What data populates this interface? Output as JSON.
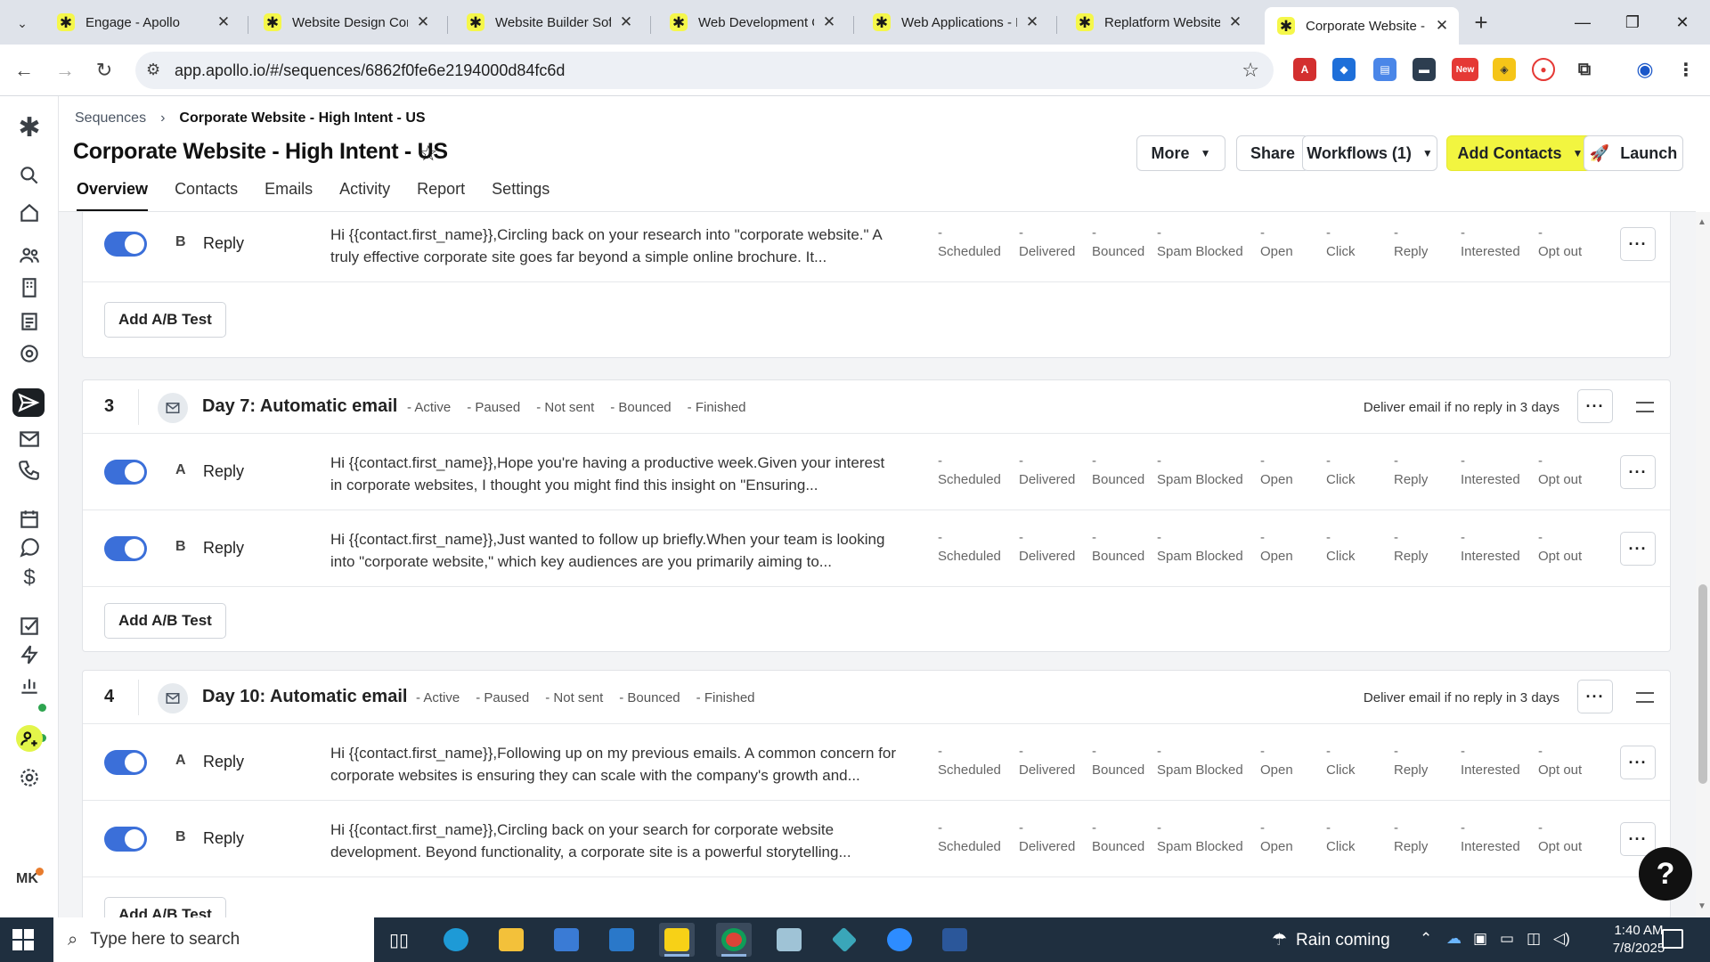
{
  "browser": {
    "tabs": [
      {
        "title": "Engage - Apollo"
      },
      {
        "title": "Website Design Com"
      },
      {
        "title": "Website Builder Softv"
      },
      {
        "title": "Web Development C"
      },
      {
        "title": "Web Applications - H"
      },
      {
        "title": "Replatform Website"
      },
      {
        "title": "Corporate Website -",
        "active": true
      }
    ],
    "url": "app.apollo.io/#/sequences/6862f0fe6e2194000d84fc6d",
    "ext_badge": "New"
  },
  "app": {
    "breadcrumb": {
      "parent": "Sequences",
      "current": "Corporate Website - High Intent - US"
    },
    "title": "Corporate Website - High Intent - US",
    "buttons": {
      "more": "More",
      "share": "Share",
      "workflows": "Workflows (1)",
      "add_contacts": "Add Contacts",
      "launch": "Launch"
    },
    "tabs": [
      "Overview",
      "Contacts",
      "Emails",
      "Activity",
      "Report",
      "Settings"
    ],
    "active_tab": "Overview",
    "user_initials": "MK",
    "metric_dash": "-",
    "metric_labels": [
      "Scheduled",
      "Delivered",
      "Bounced",
      "Spam Blocked",
      "Open",
      "Click",
      "Reply",
      "Interested",
      "Opt out"
    ],
    "step_stat_labels": [
      "- Active",
      "- Paused",
      "- Not sent",
      "- Bounced",
      "- Finished"
    ],
    "ab_test_label": "Add A/B Test",
    "dots": "···"
  },
  "steps": [
    {
      "number": "",
      "title": "",
      "variants": [
        {
          "letter": "B",
          "type": "Reply",
          "preview": "Hi {{contact.first_name}},Circling back on your research into \"corporate website.\" A truly effective corporate site goes far beyond a simple online brochure. It..."
        }
      ]
    },
    {
      "number": "3",
      "title": "Day 7: Automatic email",
      "condition": "Deliver email if no reply in 3 days",
      "variants": [
        {
          "letter": "A",
          "type": "Reply",
          "preview": "Hi {{contact.first_name}},Hope you're having a productive week.Given your interest in corporate websites, I thought you might find this insight on \"Ensuring..."
        },
        {
          "letter": "B",
          "type": "Reply",
          "preview": "Hi {{contact.first_name}},Just wanted to follow up briefly.When your team is looking into \"corporate website,\" which key audiences are you primarily aiming to..."
        }
      ]
    },
    {
      "number": "4",
      "title": "Day 10: Automatic email",
      "condition": "Deliver email if no reply in 3 days",
      "variants": [
        {
          "letter": "A",
          "type": "Reply",
          "preview": "Hi {{contact.first_name}},Following up on my previous emails. A common concern for corporate websites is ensuring they can scale with the company's growth and..."
        },
        {
          "letter": "B",
          "type": "Reply",
          "preview": "Hi {{contact.first_name}},Circling back on your search for corporate website development. Beyond functionality, a corporate site is a powerful storytelling..."
        }
      ]
    }
  ],
  "help_label": "?",
  "taskbar": {
    "search_placeholder": "Type here to search",
    "weather": "Rain coming",
    "time": "1:40 AM",
    "date": "7/8/2025"
  },
  "colors": {
    "brand_yellow": "#f2f540",
    "toggle_blue": "#3b6fd9",
    "taskbar": "#1f2f3f"
  }
}
